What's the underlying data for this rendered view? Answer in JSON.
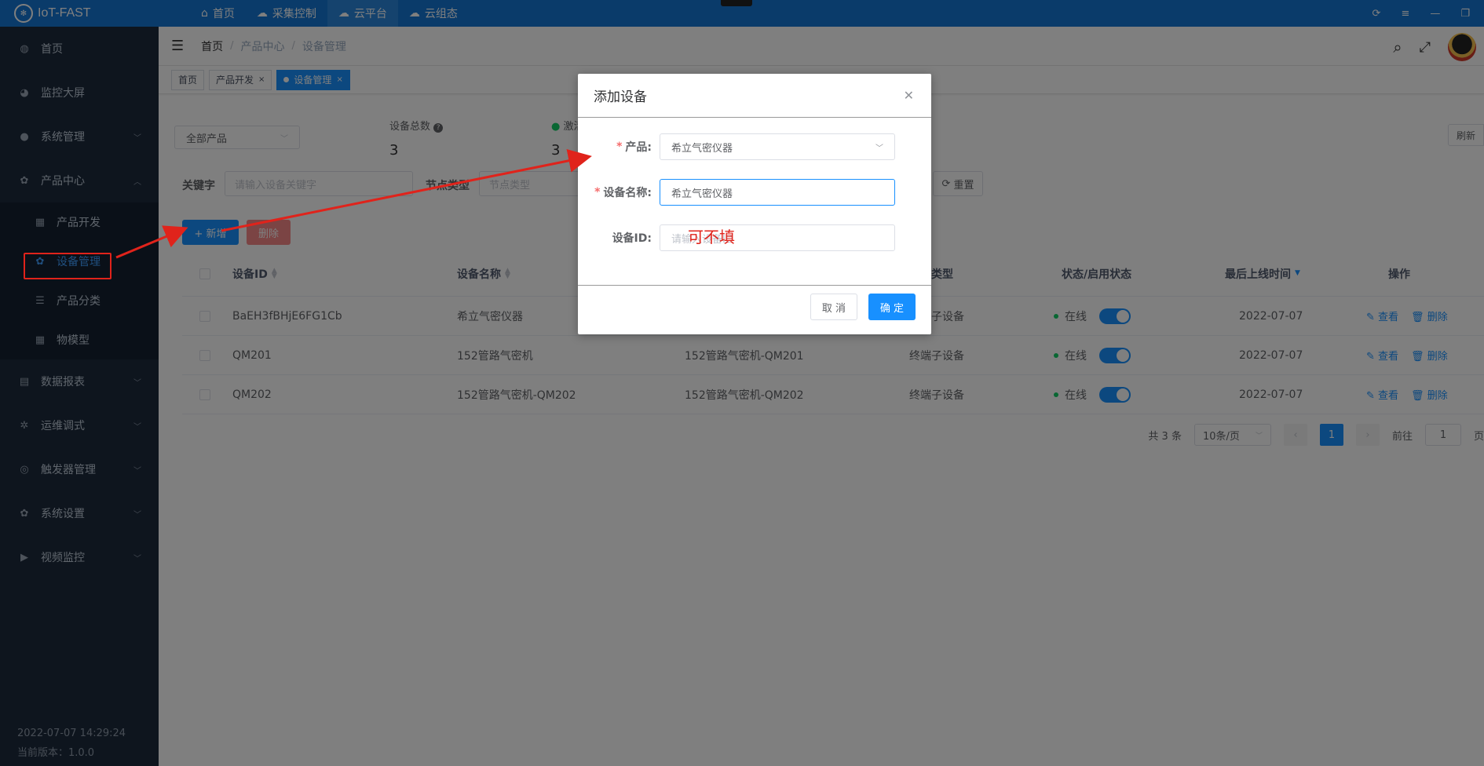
{
  "topbar": {
    "app_title": "IoT-FAST",
    "nav": [
      {
        "icon": "home-icon",
        "label": "首页"
      },
      {
        "icon": "collect-control-icon",
        "label": "采集控制"
      },
      {
        "icon": "cloud-platform-icon",
        "label": "云平台"
      },
      {
        "icon": "cloud-config-icon",
        "label": "云组态"
      }
    ],
    "active_nav": "云平台"
  },
  "sidebar": {
    "items": [
      {
        "label": "首页"
      },
      {
        "label": "监控大屏"
      },
      {
        "label": "系统管理"
      },
      {
        "label": "产品中心"
      },
      {
        "label": "数据报表"
      },
      {
        "label": "运维调式"
      },
      {
        "label": "触发器管理"
      },
      {
        "label": "系统设置"
      },
      {
        "label": "视频监控"
      }
    ],
    "sub_items": [
      {
        "label": "产品开发"
      },
      {
        "label": "设备管理"
      },
      {
        "label": "产品分类"
      },
      {
        "label": "物模型"
      }
    ],
    "footer_time": "2022-07-07 14:29:24",
    "footer_version": "当前版本：1.0.0"
  },
  "breadcrumb": [
    "首页",
    "产品中心",
    "设备管理"
  ],
  "tags": [
    "首页",
    "产品开发",
    "设备管理"
  ],
  "filters": {
    "product_select": "全部产品",
    "stat_total_label": "设备总数",
    "stat_total_value": "3",
    "stat_active_label": "激活",
    "stat_active_value": "3",
    "refresh_label": "刷新",
    "keyword_label": "关键字",
    "keyword_placeholder": "请输入设备关键字",
    "node_type_label": "节点类型",
    "node_type_placeholder": "节点类型",
    "reset_label": "重置",
    "add_label": "+ 新增",
    "delete_label": "删除"
  },
  "table": {
    "columns": {
      "id": "设备ID",
      "name": "设备名称",
      "node_type": "节点类型",
      "status": "状态/启用状态",
      "last_online": "最后上线时间",
      "ops": "操作"
    },
    "rows": [
      {
        "id": "BaEH3fBHjE6FG1Cb",
        "name": "希立气密仪器",
        "product": "",
        "node_type": "终端子设备",
        "status": "在线",
        "last_online": "2022-07-07"
      },
      {
        "id": "QM201",
        "name": "152管路气密机",
        "product": "152管路气密机-QM201",
        "node_type": "终端子设备",
        "status": "在线",
        "last_online": "2022-07-07"
      },
      {
        "id": "QM202",
        "name": "152管路气密机-QM202",
        "product": "152管路气密机-QM202",
        "node_type": "终端子设备",
        "status": "在线",
        "last_online": "2022-07-07"
      }
    ],
    "op_view": "查看",
    "op_delete": "删除"
  },
  "pager": {
    "total": "共 3 条",
    "page_size": "10条/页",
    "current": "1",
    "goto_label": "前往",
    "goto_value": "1",
    "page_suffix": "页"
  },
  "dialog": {
    "title": "添加设备",
    "product_label": "产品:",
    "product_value": "希立气密仪器",
    "device_name_label": "设备名称:",
    "device_name_value": "希立气密仪器",
    "device_id_label": "设备ID:",
    "device_id_placeholder": "请输入设备ID",
    "annotation": "可不填",
    "cancel_label": "取 消",
    "confirm_label": "确 定"
  },
  "colors": {
    "primary": "#1890ff",
    "topbar": "#1476d4",
    "sidebar": "#1d2b3c",
    "annotation": "#e0231b"
  }
}
